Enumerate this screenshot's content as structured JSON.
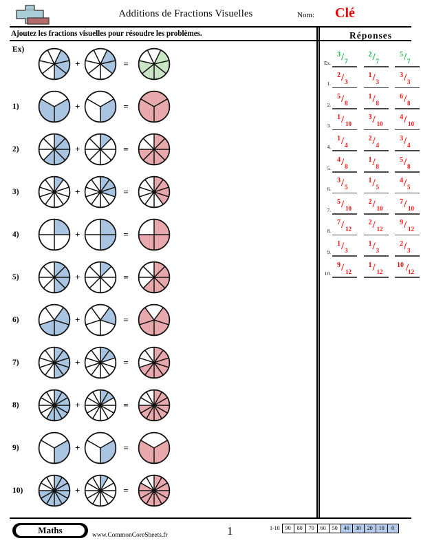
{
  "header": {
    "title": "Additions de Fractions Visuelles",
    "name_label": "Nom:",
    "name_value": "Clé",
    "instructions": "Ajoutez les fractions visuelles pour résoudre les problèmes.",
    "logo_name": "plus-sign-logo"
  },
  "answers": {
    "heading": "Réponses",
    "rows": [
      {
        "label": "Ex.",
        "color": "green",
        "cells": [
          {
            "num": "3",
            "den": "7"
          },
          {
            "num": "2",
            "den": "7"
          },
          {
            "num": "5",
            "den": "7"
          }
        ]
      },
      {
        "label": "1.",
        "color": "red",
        "cells": [
          {
            "num": "2",
            "den": "3"
          },
          {
            "num": "1",
            "den": "3"
          },
          {
            "num": "3",
            "den": "3"
          }
        ]
      },
      {
        "label": "2.",
        "color": "red",
        "cells": [
          {
            "num": "5",
            "den": "8"
          },
          {
            "num": "1",
            "den": "8"
          },
          {
            "num": "6",
            "den": "8"
          }
        ]
      },
      {
        "label": "3.",
        "color": "red",
        "cells": [
          {
            "num": "1",
            "den": "10"
          },
          {
            "num": "3",
            "den": "10"
          },
          {
            "num": "4",
            "den": "10"
          }
        ]
      },
      {
        "label": "4.",
        "color": "red",
        "cells": [
          {
            "num": "1",
            "den": "4"
          },
          {
            "num": "2",
            "den": "4"
          },
          {
            "num": "3",
            "den": "4"
          }
        ]
      },
      {
        "label": "5.",
        "color": "red",
        "cells": [
          {
            "num": "4",
            "den": "8"
          },
          {
            "num": "1",
            "den": "8"
          },
          {
            "num": "5",
            "den": "8"
          }
        ]
      },
      {
        "label": "6.",
        "color": "red",
        "cells": [
          {
            "num": "3",
            "den": "5"
          },
          {
            "num": "1",
            "den": "5"
          },
          {
            "num": "4",
            "den": "5"
          }
        ]
      },
      {
        "label": "7.",
        "color": "red",
        "cells": [
          {
            "num": "5",
            "den": "10"
          },
          {
            "num": "2",
            "den": "10"
          },
          {
            "num": "7",
            "den": "10"
          }
        ]
      },
      {
        "label": "8.",
        "color": "red",
        "cells": [
          {
            "num": "7",
            "den": "12"
          },
          {
            "num": "2",
            "den": "12"
          },
          {
            "num": "9",
            "den": "12"
          }
        ]
      },
      {
        "label": "9.",
        "color": "red",
        "cells": [
          {
            "num": "1",
            "den": "3"
          },
          {
            "num": "1",
            "den": "3"
          },
          {
            "num": "2",
            "den": "3"
          }
        ]
      },
      {
        "label": "10.",
        "color": "red",
        "cells": [
          {
            "num": "9",
            "den": "12"
          },
          {
            "num": "1",
            "den": "12"
          },
          {
            "num": "10",
            "den": "12"
          }
        ]
      }
    ]
  },
  "problems": [
    {
      "label": "Ex)",
      "denominator": 7,
      "a": 3,
      "b": 2,
      "sum": 5,
      "result_color": "green",
      "start_offset": 0.5,
      "size": 48
    },
    {
      "label": "1)",
      "denominator": 3,
      "a": 2,
      "b": 1,
      "sum": 3,
      "result_color": "pink",
      "start_offset": 0.5,
      "size": 48
    },
    {
      "label": "2)",
      "denominator": 8,
      "a": 5,
      "b": 1,
      "sum": 6,
      "result_color": "pink",
      "start_offset": 0,
      "size": 48
    },
    {
      "label": "3)",
      "denominator": 10,
      "a": 1,
      "b": 3,
      "sum": 4,
      "result_color": "pink",
      "start_offset": 0,
      "size": 48
    },
    {
      "label": "4)",
      "denominator": 4,
      "a": 1,
      "b": 2,
      "sum": 3,
      "result_color": "pink",
      "start_offset": 0,
      "size": 48
    },
    {
      "label": "5)",
      "denominator": 8,
      "a": 4,
      "b": 1,
      "sum": 5,
      "result_color": "pink",
      "start_offset": 0,
      "size": 48
    },
    {
      "label": "6)",
      "denominator": 5,
      "a": 3,
      "b": 1,
      "sum": 4,
      "result_color": "pink",
      "start_offset": 0.5,
      "size": 48
    },
    {
      "label": "7)",
      "denominator": 10,
      "a": 5,
      "b": 2,
      "sum": 7,
      "result_color": "pink",
      "start_offset": 0,
      "size": 48
    },
    {
      "label": "8)",
      "denominator": 12,
      "a": 7,
      "b": 2,
      "sum": 9,
      "result_color": "pink",
      "start_offset": 0,
      "size": 48
    },
    {
      "label": "9)",
      "denominator": 3,
      "a": 1,
      "b": 1,
      "sum": 2,
      "result_color": "pink",
      "start_offset": 0.5,
      "size": 48
    },
    {
      "label": "10)",
      "denominator": 12,
      "a": 9,
      "b": 1,
      "sum": 10,
      "result_color": "pink",
      "start_offset": 0,
      "size": 48
    }
  ],
  "operators": {
    "plus": "+",
    "equals": "="
  },
  "colors": {
    "blue_fill": "#a8c4e0",
    "pink_fill": "#e8a9ad",
    "green_fill": "#c9e5c6",
    "answer_red": "#f60c0c",
    "answer_green": "#11b341",
    "scale_highlight": "#b6cdee",
    "logo_blue": "#a8cdd6",
    "logo_red": "#b56a6a"
  },
  "footer": {
    "brand": "Maths",
    "site": "www.CommonCoreSheets.fr",
    "page_number": "1",
    "scale_range": "1-10",
    "scale_values": [
      "90",
      "80",
      "70",
      "60",
      "50",
      "40",
      "30",
      "20",
      "10",
      "0"
    ],
    "scale_highlight_from_index": 5
  }
}
